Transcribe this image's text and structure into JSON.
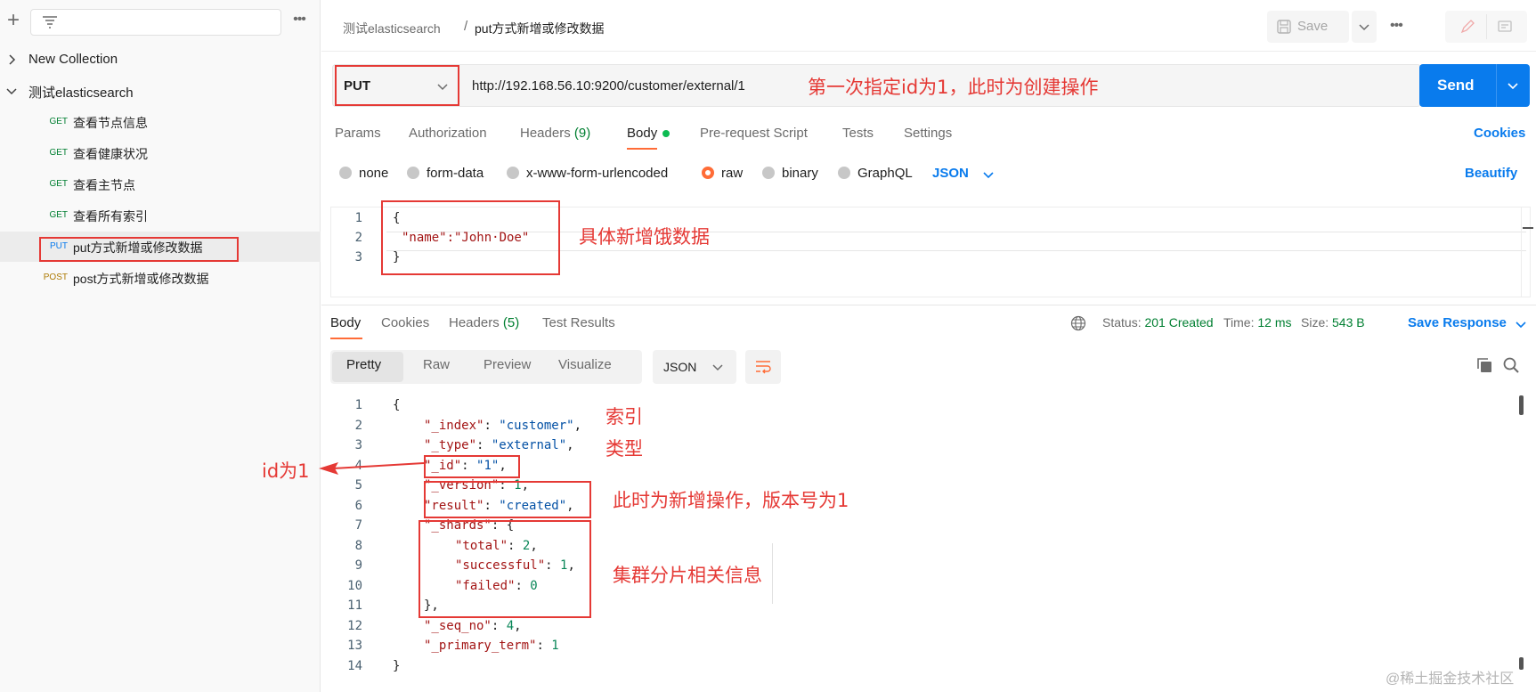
{
  "sidebar": {
    "new_collection": "New Collection",
    "collection": "测试elasticsearch",
    "requests": [
      {
        "method": "GET",
        "name": "查看节点信息"
      },
      {
        "method": "GET",
        "name": "查看健康状况"
      },
      {
        "method": "GET",
        "name": "查看主节点"
      },
      {
        "method": "GET",
        "name": "查看所有索引"
      },
      {
        "method": "PUT",
        "name": "put方式新增或修改数据"
      },
      {
        "method": "POST",
        "name": "post方式新增或修改数据"
      }
    ]
  },
  "header": {
    "breadcrumb_parent": "测试elasticsearch",
    "breadcrumb_sep": "/",
    "breadcrumb_current": "put方式新增或修改数据",
    "save_label": "Save"
  },
  "request": {
    "method": "PUT",
    "url": "http://192.168.56.10:9200/customer/external/1",
    "send_label": "Send",
    "tabs": {
      "params": "Params",
      "authorization": "Authorization",
      "headers": "Headers",
      "headers_count": "(9)",
      "body": "Body",
      "prerequest": "Pre-request Script",
      "tests": "Tests",
      "settings": "Settings"
    },
    "cookies": "Cookies",
    "body_types": [
      "none",
      "form-data",
      "x-www-form-urlencoded",
      "raw",
      "binary",
      "GraphQL"
    ],
    "body_format": "JSON",
    "beautify": "Beautify",
    "body_lines": [
      "{",
      "\"name\":\"John·Doe\"",
      "}"
    ]
  },
  "response": {
    "tabs": {
      "body": "Body",
      "cookies": "Cookies",
      "headers": "Headers",
      "headers_count": "(5)",
      "test_results": "Test Results"
    },
    "status_label": "Status:",
    "status_value": "201 Created",
    "time_label": "Time:",
    "time_value": "12 ms",
    "size_label": "Size:",
    "size_value": "543 B",
    "save_response": "Save Response",
    "views": [
      "Pretty",
      "Raw",
      "Preview",
      "Visualize"
    ],
    "format": "JSON",
    "lines": [
      {
        "k": "",
        "v": "{"
      },
      {
        "k": "\"_index\"",
        "v": "\"customer\""
      },
      {
        "k": "\"_type\"",
        "v": "\"external\""
      },
      {
        "k": "\"_id\"",
        "v": "\"1\""
      },
      {
        "k": "\"_version\"",
        "v": "1"
      },
      {
        "k": "\"result\"",
        "v": "\"created\""
      },
      {
        "k": "\"_shards\"",
        "v": "{"
      },
      {
        "k": "\"total\"",
        "v": "2"
      },
      {
        "k": "\"successful\"",
        "v": "1"
      },
      {
        "k": "\"failed\"",
        "v": "0"
      },
      {
        "k": "",
        "v": "},"
      },
      {
        "k": "\"_seq_no\"",
        "v": "4"
      },
      {
        "k": "\"_primary_term\"",
        "v": "1"
      },
      {
        "k": "",
        "v": "}"
      }
    ]
  },
  "annotations": {
    "url_note": "第一次指定id为1，此时为创建操作",
    "body_note": "具体新增饿数据",
    "index_note": "索引",
    "type_note": "类型",
    "id_note": "id为1",
    "version_note": "此时为新增操作，版本号为1",
    "shards_note": "集群分片相关信息"
  },
  "watermark": "@稀土掘金技术社区",
  "colors": {
    "accent": "#ff6c37",
    "primary": "#097bed",
    "annotation": "#e53935",
    "success": "#007f31"
  }
}
